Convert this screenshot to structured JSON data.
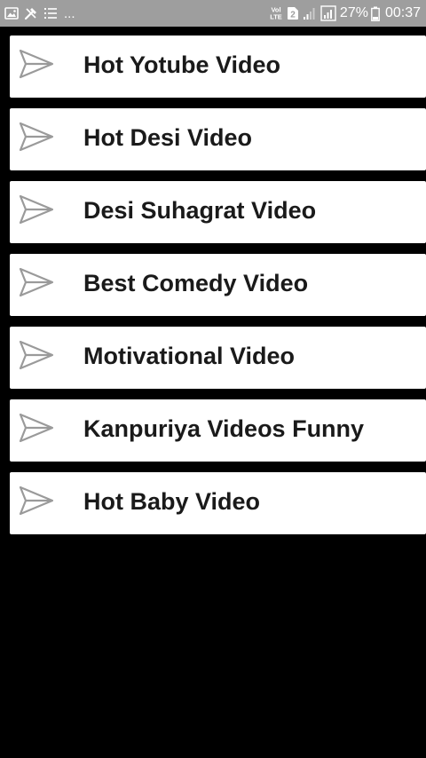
{
  "status_bar": {
    "left_icons": [
      "image-icon",
      "tools-icon",
      "list-icon"
    ],
    "overflow_text": "...",
    "volte_line1": "Vol",
    "volte_line2": "LTE",
    "sim_badge": "2",
    "battery_percent": "27%",
    "time": "00:37"
  },
  "video_list": {
    "item_icon": "send-arrow-icon",
    "items": [
      {
        "label": "Hot Yotube Video"
      },
      {
        "label": "Hot Desi Video"
      },
      {
        "label": "Desi Suhagrat Video"
      },
      {
        "label": "Best Comedy Video"
      },
      {
        "label": "Motivational Video"
      },
      {
        "label": "Kanpuriya Videos Funny"
      },
      {
        "label": "Hot Baby Video"
      }
    ]
  },
  "colors": {
    "background": "#000000",
    "status_bar": "#9e9e9e",
    "card": "#ffffff",
    "text": "#1a1a1a",
    "icon_stroke": "#9a9a9a"
  }
}
